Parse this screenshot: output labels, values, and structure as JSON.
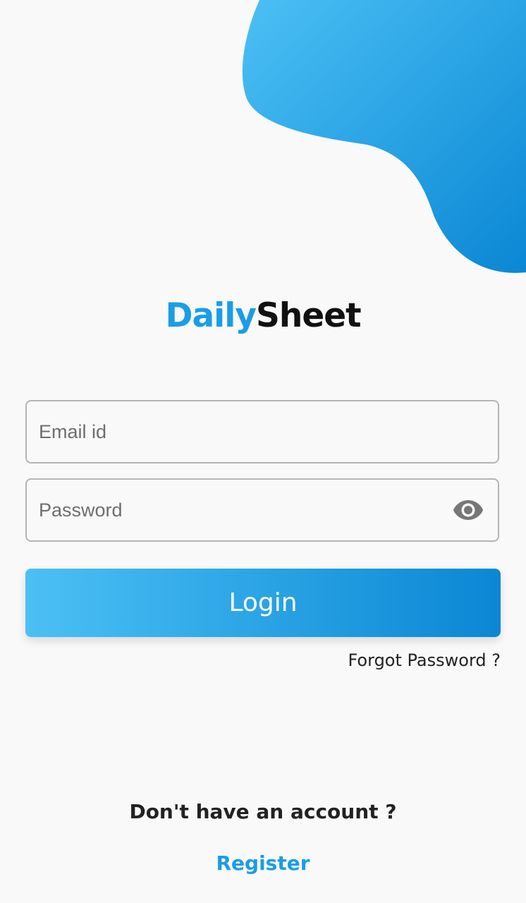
{
  "brand": {
    "name_part1": "Daily",
    "name_part2": "Sheet"
  },
  "form": {
    "email_placeholder": "Email id",
    "email_value": "",
    "password_placeholder": "Password",
    "password_value": "",
    "password_toggle_icon": "eye-icon",
    "login_label": "Login",
    "forgot_label": "Forgot Password ?"
  },
  "footer": {
    "prompt": "Don't have an account ?",
    "register_label": "Register"
  },
  "colors": {
    "accent": "#1a9de6",
    "gradient_start": "#4cc0f5",
    "gradient_end": "#0a87d4",
    "background": "#f9f9f9"
  }
}
